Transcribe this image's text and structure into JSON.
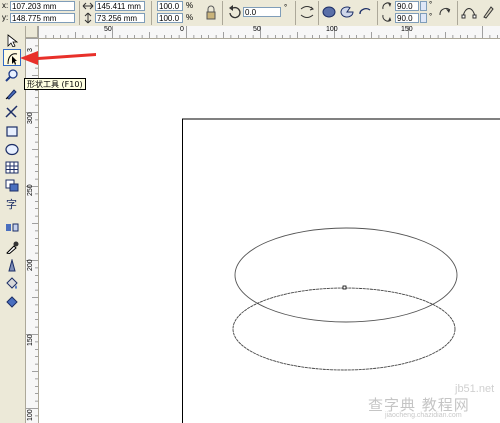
{
  "property_bar": {
    "x_label": "x:",
    "x_value": "107.203 mm",
    "y_label": "y:",
    "y_value": "148.775 mm",
    "width_value": "145.411 mm",
    "height_value": "73.256 mm",
    "scale_x": "100.0",
    "scale_y": "100.0",
    "percent": "%",
    "rotation_value": "0.0",
    "degree": "°",
    "start_angle": "90.0",
    "end_angle": "90.0"
  },
  "rulers": {
    "horizontal": [
      "50",
      "0",
      "50",
      "100",
      "150"
    ],
    "vertical": [
      "3",
      "300",
      "250",
      "200",
      "150",
      "100"
    ]
  },
  "tooltip": "形状工具 (F10)",
  "watermark": {
    "site": "jb51.net",
    "cn": "查字典 教程网",
    "url": "jiaocheng.chazidian.com"
  },
  "colors": {
    "toolbar_bg": "#ece9d8",
    "highlight": "#316ac5",
    "arrow": "#e8302a"
  }
}
